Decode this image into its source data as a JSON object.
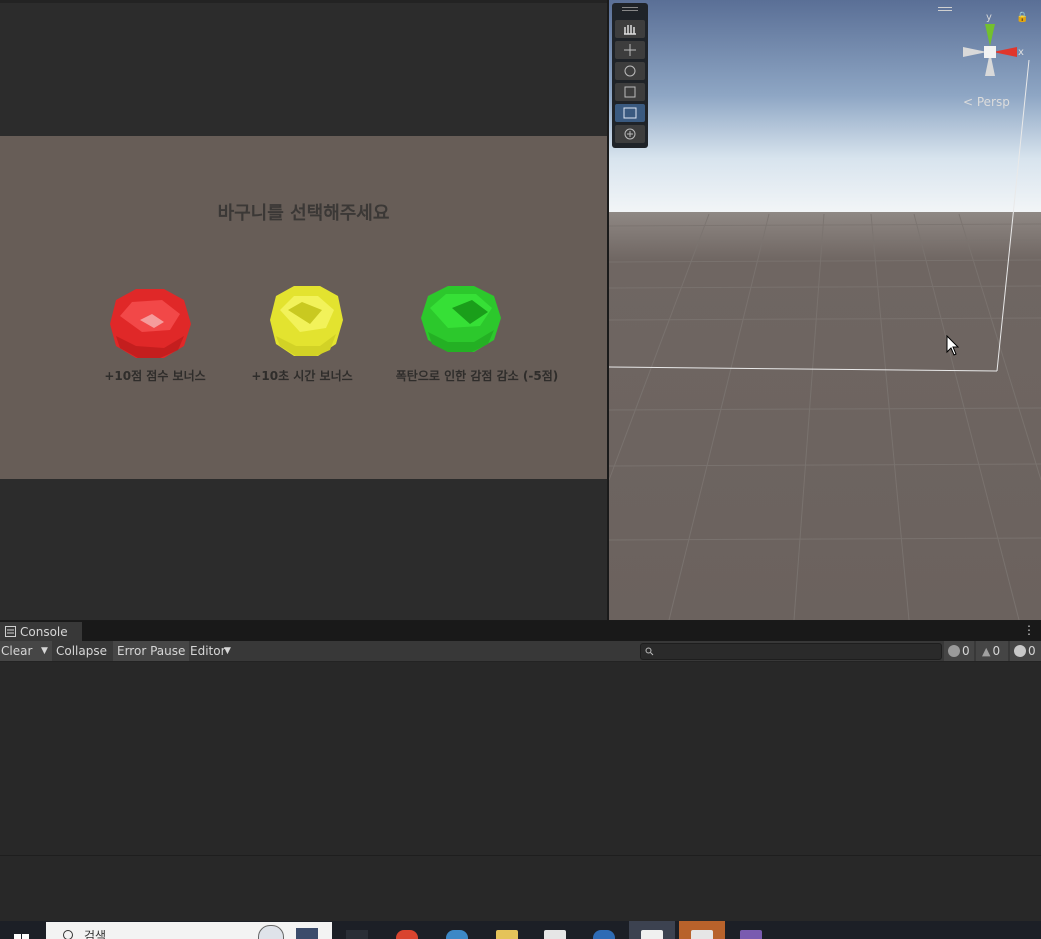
{
  "game": {
    "title": "바구니를 선택해주세요",
    "baskets": [
      {
        "label": "+10점 점수 보너스",
        "color": "#e62a2a"
      },
      {
        "label": "+10초 시간 보너스",
        "color": "#e9e93a"
      },
      {
        "label": "폭탄으로 인한 감점 감소 (-5점)",
        "color": "#2fd62f"
      }
    ]
  },
  "scene": {
    "persp_label": "< Persp",
    "gizmo_x": "x",
    "gizmo_y": "y",
    "tools": [
      "hand-tool",
      "move-tool",
      "rotate-tool",
      "scale-tool",
      "rect-tool",
      "transform-tool"
    ]
  },
  "console": {
    "tab_label": "Console",
    "clear_label": "Clear",
    "collapse_label": "Collapse",
    "error_pause_label": "Error Pause",
    "editor_label": "Editor",
    "search_placeholder": "",
    "info_count": "0",
    "warning_count": "0",
    "error_count": "0"
  },
  "taskbar": {
    "search_text": "검색"
  },
  "colors": {
    "sky_top": "#5a6f96",
    "sky_horizon": "#dfe9f2",
    "ground": "#6b625e",
    "game_bg": "#675d57",
    "panel_bg": "#282828"
  }
}
